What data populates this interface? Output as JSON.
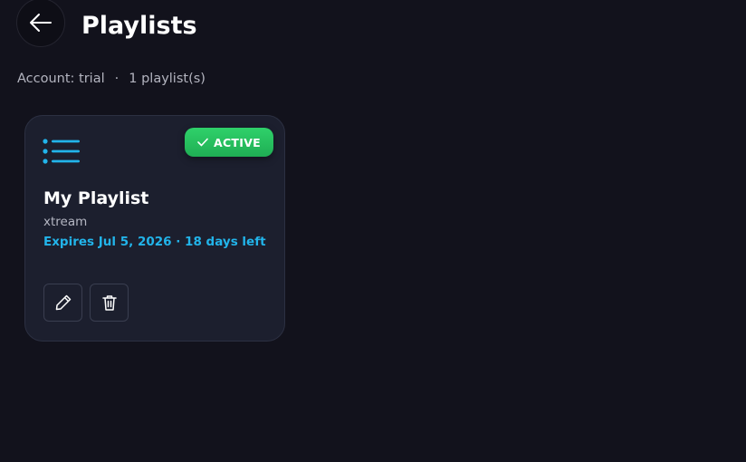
{
  "header": {
    "title": "Playlists"
  },
  "meta": {
    "account": "Account: trial",
    "separator": "·",
    "count": "1 playlist(s)"
  },
  "playlists": [
    {
      "name": "My Playlist",
      "type": "xtream",
      "expiry": "Expires Jul 5, 2026 · 18 days left",
      "status": "ACTIVE",
      "icon": "list-icon"
    }
  ],
  "colors": {
    "background": "#12121c",
    "card": "#1c1f2e",
    "accent": "#22b4ea",
    "active": "#28c060"
  }
}
